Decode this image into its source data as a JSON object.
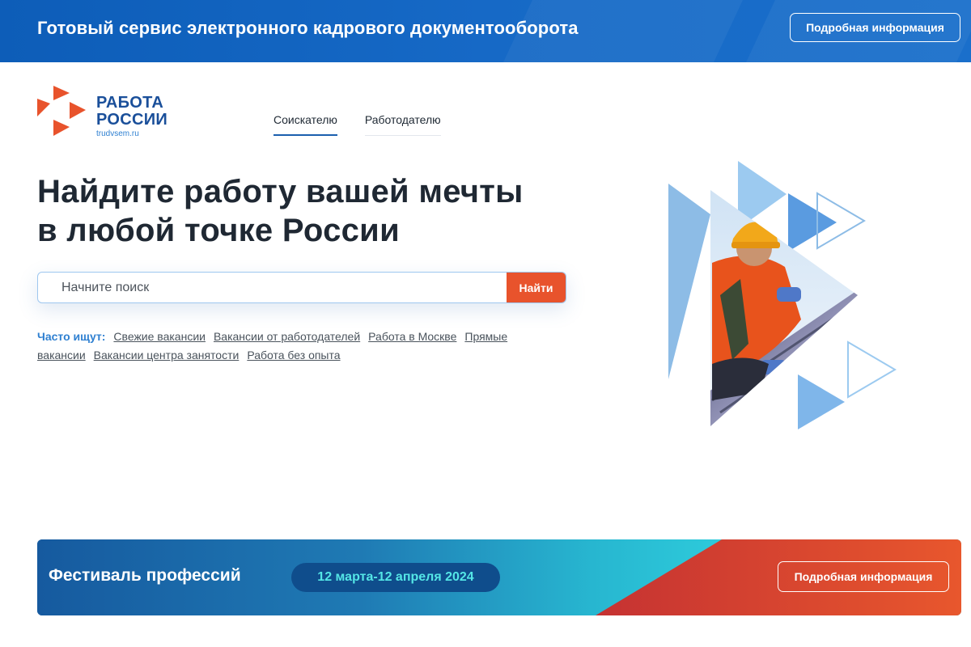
{
  "top_banner": {
    "title": "Готовый сервис электронного кадрового документооборота",
    "button_label": "Подробная информация"
  },
  "logo": {
    "line1": "РАБОТА",
    "line2": "РОССИИ",
    "domain": "trudvsem.ru",
    "icon": "logo-arrows-icon",
    "colors": {
      "arrows": "#e8532c",
      "text": "#1a4f9a"
    }
  },
  "tabs": [
    {
      "label": "Соискателю",
      "active": true
    },
    {
      "label": "Работодателю",
      "active": false
    }
  ],
  "hero": {
    "headline_line1": "Найдите работу вашей мечты",
    "headline_line2": "в любой точке России"
  },
  "search": {
    "placeholder": "Начните поиск",
    "value": "",
    "button_label": "Найти"
  },
  "popular": {
    "label": "Часто ищут:",
    "links": [
      "Свежие вакансии",
      "Вакансии от работодателей",
      "Работа в Москве",
      "Прямые вакансии",
      "Вакансии центра занятости",
      "Работа без опыта"
    ]
  },
  "festival": {
    "title": "Фестиваль профессий",
    "dates": "12 марта-12 апреля 2024",
    "button_label": "Подробная информация"
  },
  "colors": {
    "accent": "#e8532c",
    "brand_blue": "#1a4f9a",
    "banner_blue": "#1669c6",
    "link_blue": "#2f80d1"
  }
}
